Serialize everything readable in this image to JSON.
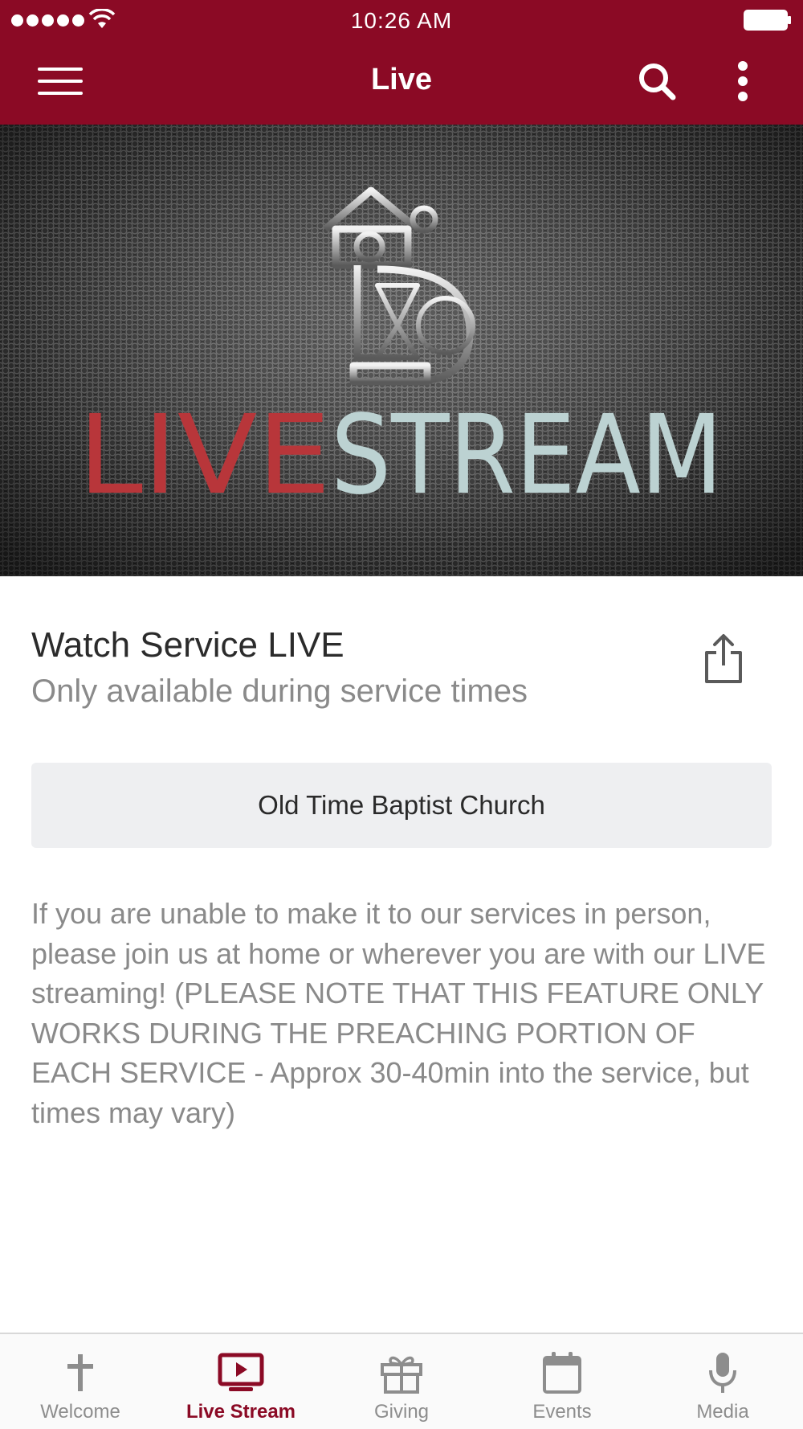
{
  "status_bar": {
    "time": "10:26 AM"
  },
  "nav": {
    "title": "Live"
  },
  "banner": {
    "logo_text_part1": "LIVE",
    "logo_text_part2": "STREAM"
  },
  "content": {
    "heading": "Watch Service LIVE",
    "subheading": "Only available during service times",
    "church_button_label": "Old Time Baptist Church",
    "description": "If you are unable to make it to our services in person, please join us at home or wherever you are with our LIVE streaming! (PLEASE NOTE THAT THIS FEATURE ONLY WORKS DURING THE PREACHING PORTION OF EACH SERVICE - Approx 30-40min into the service, but times may vary)"
  },
  "tabs": [
    {
      "label": "Welcome",
      "icon": "cross-icon",
      "active": false
    },
    {
      "label": "Live Stream",
      "icon": "tv-play-icon",
      "active": true
    },
    {
      "label": "Giving",
      "icon": "gift-icon",
      "active": false
    },
    {
      "label": "Events",
      "icon": "calendar-icon",
      "active": false
    },
    {
      "label": "Media",
      "icon": "microphone-icon",
      "active": false
    }
  ],
  "colors": {
    "brand": "#8b0a25",
    "inactive": "#8d8d8d",
    "button_bg": "#eeeff1"
  }
}
